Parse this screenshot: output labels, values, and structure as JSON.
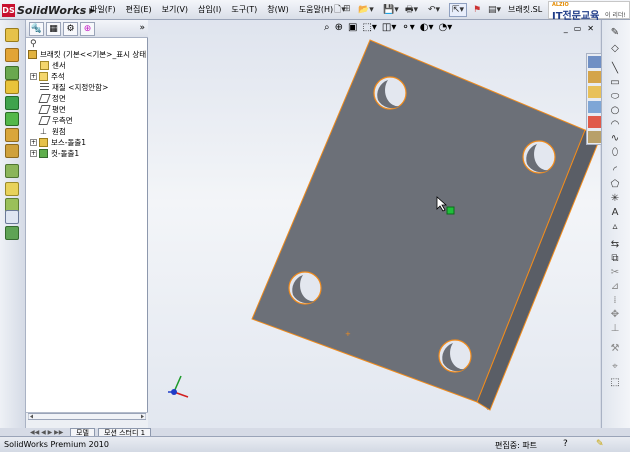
{
  "app": {
    "logo_badge": "DS",
    "name": "SolidWorks",
    "doc_name": "브래킷.SL",
    "brand_small": "ALZIO",
    "brand_big": "IT전문교육",
    "brand_tail": "이 리더!"
  },
  "menu": {
    "items": [
      "파일(F)",
      "편집(E)",
      "보기(V)",
      "삽입(I)",
      "도구(T)",
      "창(W)",
      "도움말(H)"
    ],
    "pin": "⊞"
  },
  "feature_manager": {
    "more": "»",
    "filter_icon": "funnel-icon",
    "root": "브래킷 (기본<<기본>_표시 상태",
    "nodes": [
      {
        "label": "센서",
        "icon": "sensor-icon",
        "expandable": false
      },
      {
        "label": "주석",
        "icon": "annotation-icon",
        "expandable": true
      },
      {
        "label": "재질 <지정안함>",
        "icon": "material-icon",
        "expandable": false
      },
      {
        "label": "정면",
        "icon": "plane-icon",
        "expandable": false
      },
      {
        "label": "평면",
        "icon": "plane-icon",
        "expandable": false
      },
      {
        "label": "우측면",
        "icon": "plane-icon",
        "expandable": false
      },
      {
        "label": "원점",
        "icon": "origin-icon",
        "expandable": false
      },
      {
        "label": "보스-돌출1",
        "icon": "extrude-icon",
        "expandable": true
      },
      {
        "label": "컷-돌출1",
        "icon": "cut-icon",
        "expandable": true
      }
    ]
  },
  "sheet_tabs": {
    "nav": "◀◀ ◀ ▶ ▶▶",
    "tabs": [
      "모델",
      "모션 스터디 1"
    ]
  },
  "status": {
    "left": "SolidWorks Premium 2010",
    "right": "편집중: 파트",
    "help": "?"
  },
  "viewport": {
    "win_min": "_",
    "win_restore": "▭",
    "win_close": "✕"
  },
  "colors": {
    "part_face": "#6c7078",
    "part_side": "#565a62",
    "hole_edge": "#f28c1c",
    "triad_x": "#d21f1f",
    "triad_y": "#1c9a2a",
    "triad_z": "#1f3cc8"
  }
}
